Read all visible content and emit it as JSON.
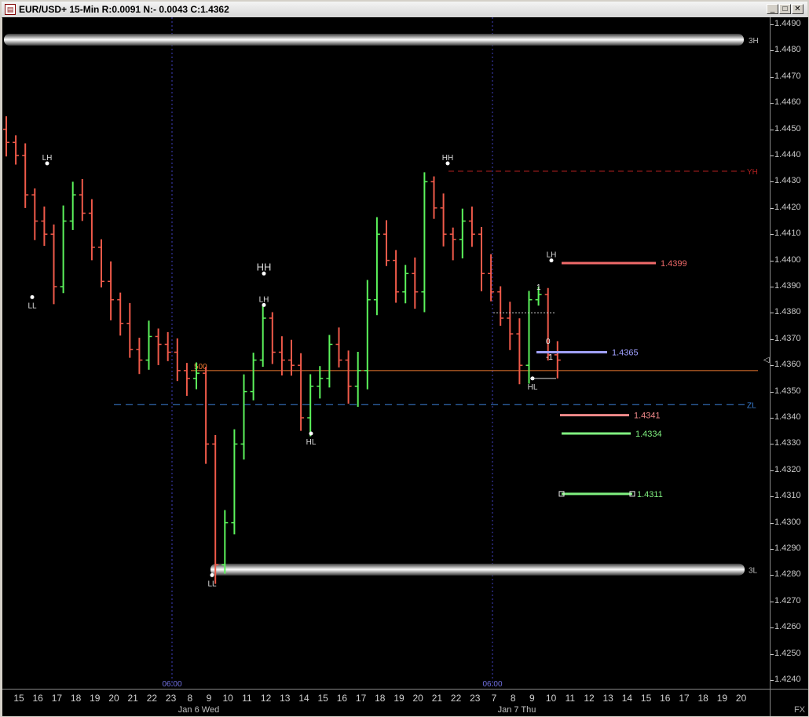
{
  "window": {
    "title": "EUR/USD+ 15-Min R:0.0091 N:- 0.0043 C:1.4362",
    "app_icon": "chart-window-icon",
    "buttons": [
      "minimize-icon",
      "maximize-icon",
      "close-icon"
    ]
  },
  "price_axis": {
    "labels": [
      "1.4490",
      "1.4480",
      "1.4470",
      "1.4460",
      "1.4450",
      "1.4440",
      "1.4430",
      "1.4420",
      "1.4410",
      "1.4400",
      "1.4390",
      "1.4380",
      "1.4370",
      "1.4360",
      "1.4350",
      "1.4340",
      "1.4330",
      "1.4320",
      "1.4310",
      "1.4300",
      "1.4290",
      "1.4280",
      "1.4270",
      "1.4260",
      "1.4250",
      "1.4240"
    ],
    "current_marker": "current-price-arrow-icon"
  },
  "time_axis": {
    "labels": [
      "15",
      "16",
      "17",
      "18",
      "19",
      "20",
      "21",
      "22",
      "23",
      "8",
      "9",
      "10",
      "11",
      "12",
      "13",
      "14",
      "15",
      "16",
      "17",
      "18",
      "19",
      "20",
      "21",
      "22",
      "23",
      "7",
      "8",
      "9",
      "10",
      "11",
      "12",
      "13",
      "14",
      "15",
      "16",
      "17",
      "18",
      "19",
      "20"
    ],
    "dates": [
      "Jan 6 Wed",
      "Jan 7 Thu"
    ],
    "session_marks": [
      "06:00",
      "06:00"
    ],
    "corner": "FX"
  },
  "colors": {
    "up": "#5cf45c",
    "down": "#f05a4a",
    "background": "#000000",
    "zl": "#3a7fd5",
    "yh": "#b02020",
    "level_red": "#f06a6a",
    "level_pink": "#f08a8a",
    "level_blue": "#a0a0ff",
    "level_green": "#80f080",
    "fib": "#f07a30"
  },
  "annotations": {
    "band_top": "3H",
    "band_bottom": "3L",
    "yh": "YH",
    "zl": "ZL",
    "fib": "500",
    "swings": [
      "LH",
      "LL",
      "HH",
      "LH",
      "HL",
      "LL",
      "HH",
      "LH",
      "HL"
    ],
    "counts": [
      "1",
      "0",
      "-1"
    ],
    "levels": [
      "1.4399",
      "1.4365",
      "1.4341",
      "1.4334",
      "1.4311"
    ]
  },
  "chart_data": {
    "type": "line",
    "title": "EUR/USD+ 15-Min",
    "ylim": [
      1.424,
      1.449
    ],
    "x_labels": [
      "15",
      "16",
      "17",
      "18",
      "19",
      "20",
      "21",
      "22",
      "23",
      "8",
      "9",
      "10",
      "11",
      "12",
      "13",
      "14",
      "15",
      "16",
      "17",
      "18",
      "19",
      "20",
      "21",
      "22",
      "23",
      "7",
      "8",
      "9",
      "10",
      "11",
      "12",
      "13",
      "14",
      "15",
      "16",
      "17",
      "18",
      "19",
      "20"
    ],
    "series": [
      {
        "values": [
          1.4445,
          1.444,
          1.4425,
          1.4415,
          1.441,
          1.439,
          1.4415,
          1.4425,
          1.4418,
          1.4405,
          1.4392,
          1.4385,
          1.4376,
          1.4366,
          1.4362,
          1.4371,
          1.4368,
          1.4365,
          1.4358,
          1.4355,
          1.4357,
          1.433,
          1.4284,
          1.43,
          1.433,
          1.435,
          1.4362,
          1.4378,
          1.4365,
          1.4362,
          1.436,
          1.434,
          1.4352,
          1.4355,
          1.4368,
          1.4362,
          1.4352,
          1.4358,
          1.4385,
          1.441,
          1.44,
          1.4388,
          1.4395,
          1.4388,
          1.443,
          1.442,
          1.441,
          1.4408,
          1.4415,
          1.441,
          1.4395,
          1.4388,
          1.4378,
          1.4372,
          1.436,
          1.4385,
          1.4387,
          1.4364,
          1.4362
        ]
      }
    ],
    "reference_levels": [
      {
        "label": "3H",
        "value": 1.4484
      },
      {
        "label": "YH",
        "value": 1.4434
      },
      {
        "label": "500",
        "value": 1.4358
      },
      {
        "label": "ZL",
        "value": 1.4345
      },
      {
        "label": "3L",
        "value": 1.4282
      }
    ],
    "price_levels": [
      1.4399,
      1.4365,
      1.4341,
      1.4334,
      1.4311
    ],
    "grid": false,
    "last_close": 1.4362
  }
}
